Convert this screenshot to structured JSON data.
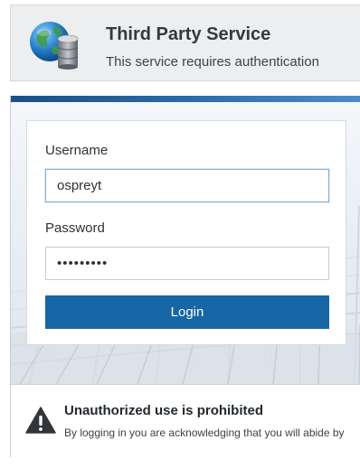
{
  "header": {
    "title": "Third Party Service",
    "subtitle": "This service requires authentication",
    "logo_icon": "globe-database-icon"
  },
  "login": {
    "username_label": "Username",
    "username_value": "ospreyt",
    "password_label": "Password",
    "password_value": "•••••••••",
    "login_button": "Login"
  },
  "warning": {
    "icon": "warning-triangle-icon",
    "title": "Unauthorized use is prohibited",
    "text": "By logging in you are acknowledging that you will abide by"
  },
  "colors": {
    "accent": "#1766a6",
    "header_bg": "#eceeef",
    "input_focus": "#7fb0d8"
  }
}
